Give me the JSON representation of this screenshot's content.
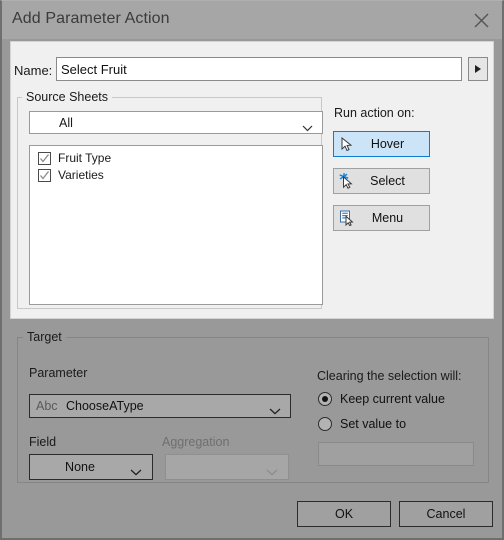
{
  "window": {
    "title": "Add Parameter Action",
    "close_icon": "close-icon"
  },
  "name_row": {
    "label": "Name:",
    "value": "Select Fruit",
    "placeholder": "",
    "expand_icon": "triangle-right-icon"
  },
  "source_sheets": {
    "group_label": "Source Sheets",
    "dropdown": {
      "value": "All",
      "chevron_icon": "chevron-down-icon"
    },
    "items": [
      {
        "label": "Fruit Type",
        "checked": true
      },
      {
        "label": "Varieties",
        "checked": true
      }
    ]
  },
  "run_action": {
    "label": "Run action on:",
    "selected": "Hover",
    "buttons": [
      {
        "id": "hover",
        "label": "Hover",
        "icon": "cursor-arrow-icon",
        "selected": true
      },
      {
        "id": "select",
        "label": "Select",
        "icon": "cursor-sparkle-select-icon",
        "selected": false
      },
      {
        "id": "menu",
        "label": "Menu",
        "icon": "cursor-menu-list-icon",
        "selected": false
      }
    ],
    "accent_color": "#0c7cd5",
    "selected_bg": "#cce4f7"
  },
  "target": {
    "group_label": "Target",
    "parameter_label": "Parameter",
    "parameter_value": {
      "type_prefix": "Abc",
      "name": "ChooseAType"
    },
    "field_label": "Field",
    "field_value": "None",
    "aggregation_label": "Aggregation",
    "aggregation_value": "",
    "clearing_label": "Clearing the selection will:",
    "options": [
      {
        "label": "Keep current value",
        "selected": true
      },
      {
        "label": "Set value to",
        "selected": false
      }
    ],
    "set_value_input": "",
    "chevron_icon": "chevron-down-icon"
  },
  "footer": {
    "ok_label": "OK",
    "cancel_label": "Cancel"
  }
}
